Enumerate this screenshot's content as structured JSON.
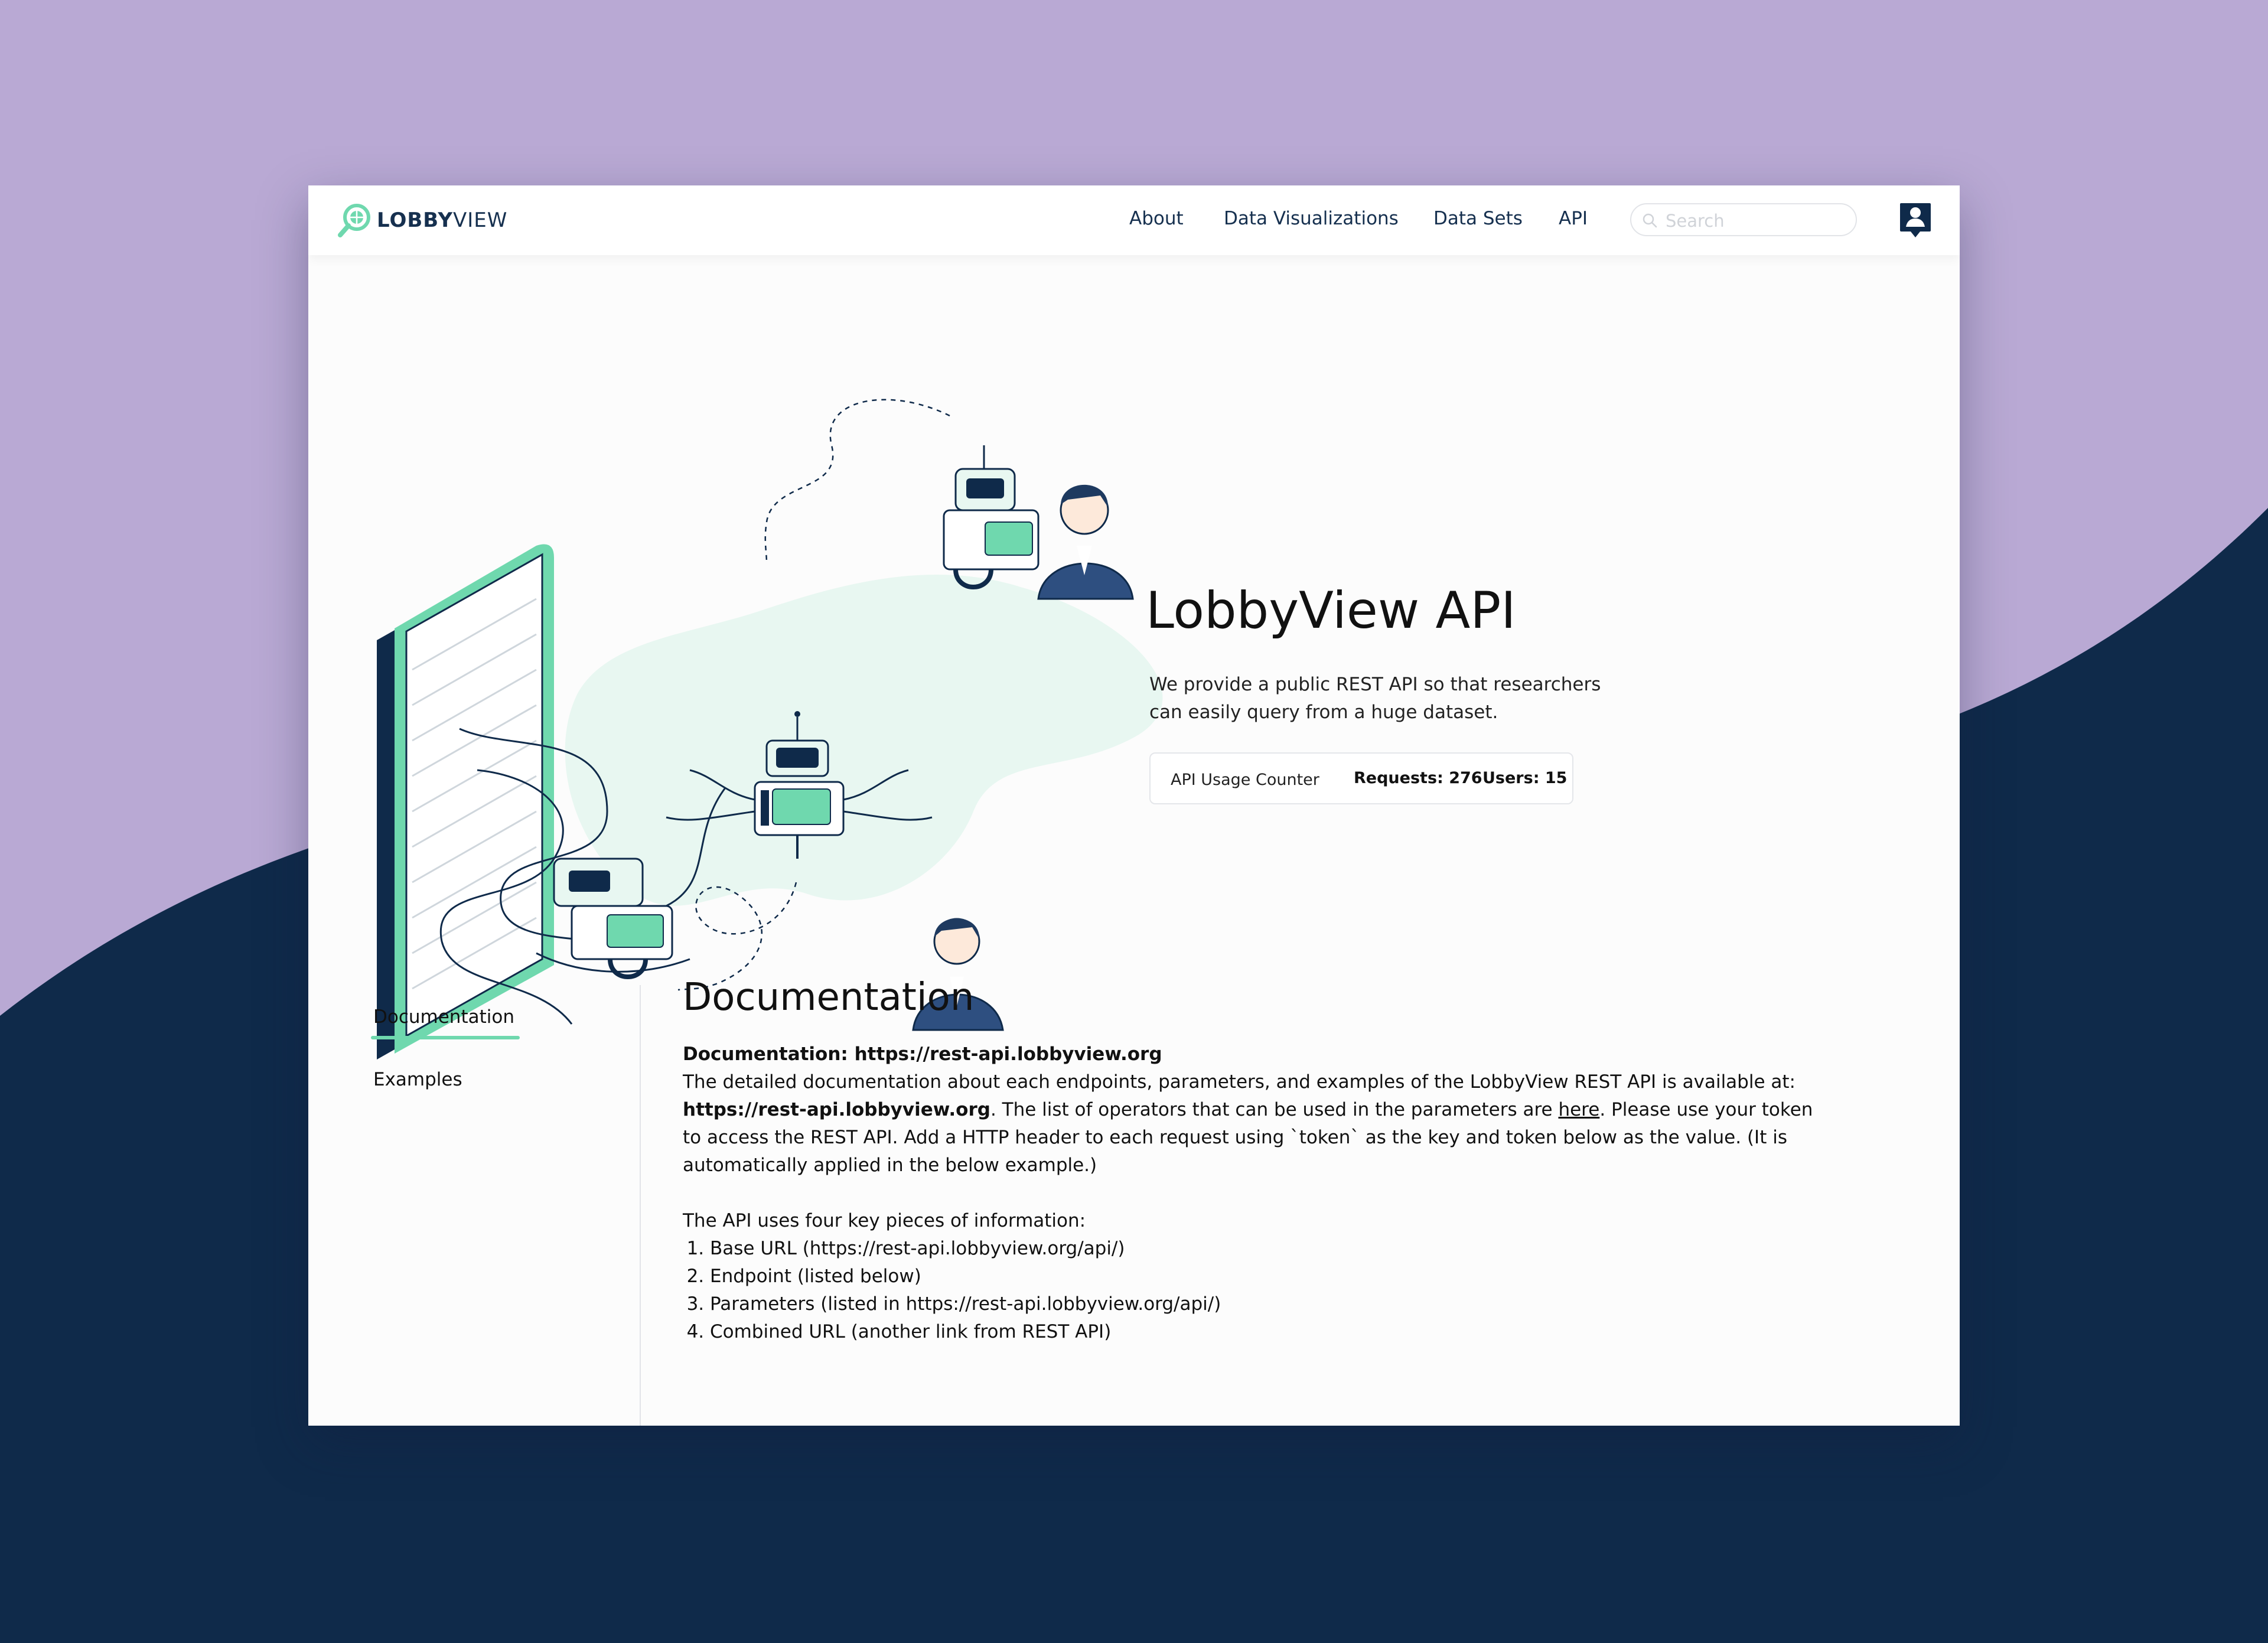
{
  "brand": {
    "name_bold": "LOBBY",
    "name_light": "VIEW"
  },
  "nav": {
    "items": [
      {
        "label": "About"
      },
      {
        "label": "Data Visualizations"
      },
      {
        "label": "Data Sets"
      },
      {
        "label": "API"
      }
    ]
  },
  "search": {
    "placeholder": "Search",
    "value": ""
  },
  "hero": {
    "title": "LobbyView API",
    "description": "We provide a public REST API so that researchers can easily query from a huge dataset.",
    "counter": {
      "label": "API Usage Counter",
      "requests": "Requests: 276",
      "users": "Users: 15"
    }
  },
  "sidebar": {
    "tabs": [
      {
        "label": "Documentation",
        "active": true
      },
      {
        "label": "Examples",
        "active": false
      }
    ]
  },
  "doc": {
    "heading": "Documentation",
    "subheading": "Documentation: https://rest-api.lobbyview.org",
    "para1_a": "The detailed documentation about each endpoints, parameters, and examples of the LobbyView REST API is available at: ",
    "para1_link": "https://rest-api.lobbyview.org",
    "para1_b": ". The list of operators that can be used in the parameters are ",
    "para1_here": "here",
    "para1_c": ". Please use your token to access the REST API. Add a HTTP header to each request using `token` as the key and token below as the value. (It is automatically applied in the below example.)",
    "list_intro": "The API uses four key pieces of information:",
    "list": [
      "Base URL (https://rest-api.lobbyview.org/api/)",
      "Endpoint (listed below)",
      "Parameters (listed in https://rest-api.lobbyview.org/api/)",
      "Combined URL (another link from REST API)"
    ]
  },
  "colors": {
    "background": "#b9a9d4",
    "navy": "#0f2a4a",
    "accent": "#6fd8ae",
    "text_dark": "#16304f"
  }
}
